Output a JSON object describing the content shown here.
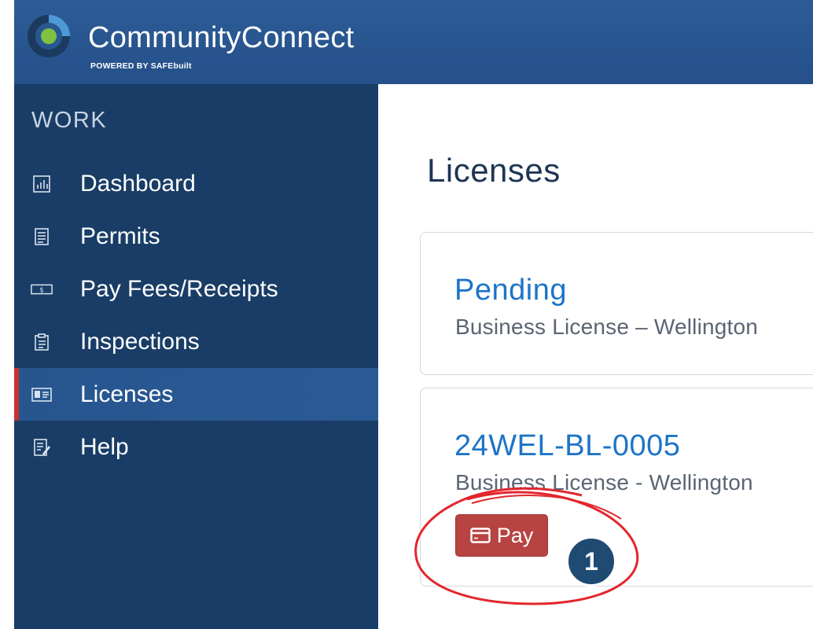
{
  "header": {
    "brand": "CommunityConnect",
    "powered_prefix": "POWERED BY ",
    "powered_brand": "SAFEbuilt"
  },
  "sidebar": {
    "section_label": "WORK",
    "items": [
      {
        "label": "Dashboard",
        "icon": "bar-chart-icon",
        "active": false
      },
      {
        "label": "Permits",
        "icon": "document-icon",
        "active": false
      },
      {
        "label": "Pay Fees/Receipts",
        "icon": "cash-icon",
        "active": false
      },
      {
        "label": "Inspections",
        "icon": "clipboard-icon",
        "active": true
      },
      {
        "label": "Licenses",
        "icon": "id-card-icon",
        "active": true
      },
      {
        "label": "Help",
        "icon": "edit-document-icon",
        "active": false
      }
    ]
  },
  "main": {
    "title": "Licenses",
    "cards": [
      {
        "link": "Pending",
        "subtitle": "Business License – Wellington"
      },
      {
        "link": "24WEL-BL-0005",
        "subtitle": "Business License - Wellington",
        "action_label": "Pay",
        "action_icon": "credit-card-icon"
      }
    ]
  },
  "annotation": {
    "step_number": "1",
    "color": "#e3262d"
  },
  "colors": {
    "header": "#25508a",
    "sidebar": "#193d66",
    "active_indicator": "#c8312f",
    "link": "#1d74c7",
    "pay_button": "#b74442"
  }
}
